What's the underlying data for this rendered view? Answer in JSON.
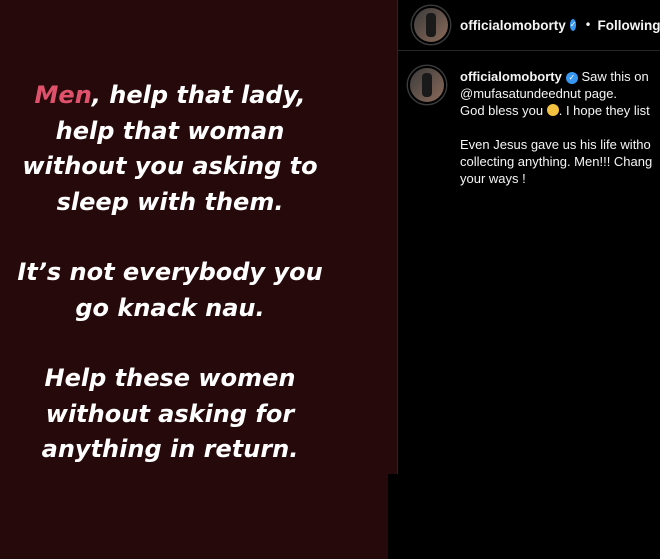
{
  "story": {
    "line1_highlight": "Men",
    "line1_rest": ", help that lady,",
    "line2": "help that woman",
    "line3": "without you asking to",
    "line4": "sleep with them.",
    "line5": "It’s not everybody you",
    "line6": "go knack nau.",
    "line7": "Help these women",
    "line8": "without asking for",
    "line9": "anything in return."
  },
  "header": {
    "username": "officialomoborty",
    "separator": "•",
    "follow_status": "Following"
  },
  "comment": {
    "username": "officialomoborty",
    "text_line1": "Saw this on",
    "text_line2": "@mufasatundeednut page.",
    "text_line3_a": "God bless you",
    "text_line3_b": ". I hope they list",
    "text_line4": "Even Jesus gave us his life witho",
    "text_line5": "collecting anything. Men!!! Chang",
    "text_line6": "your ways !"
  },
  "colors": {
    "story_bg": "#260a0b",
    "highlight": "#e0526c",
    "verified": "#3897f0"
  },
  "icons": {
    "verified": "verified-badge-icon",
    "emoji": "grinning-face-emoji-icon"
  }
}
